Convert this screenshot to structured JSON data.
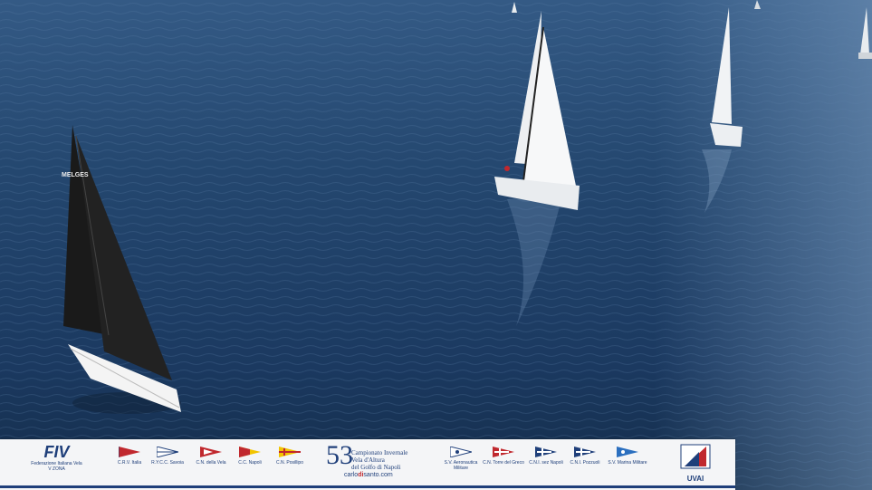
{
  "footer": {
    "federation_mark": "FIV",
    "federation_name": "Federazione Italiana Vela",
    "federation_sub": "V ZONA",
    "event_number": "53",
    "event_line1": "Campionato Invernale",
    "event_line2": "Vela d'Altura",
    "event_line3": "del Golfo di Napoli",
    "event_site_a": "carlo",
    "event_site_b": "di",
    "event_site_c": "santo.com",
    "clubs": [
      "C.R.V. Italia",
      "R.Y.C.C. Savoia",
      "C.N. della Vela",
      "C.C. Napoli",
      "C.N. Posillipo",
      "S.V. Aeronautica Militare",
      "C.N. Torre del Greco",
      "C.N.I. sez Napoli",
      "C.N.I. Pozzuoli",
      "S.V. Marina Militare"
    ],
    "uvai_label": "UVAI"
  },
  "colors": {
    "sea_dark": "#142d4a",
    "sea_mid": "#2a4d75",
    "navy": "#1f3f7a",
    "red": "#c0282e"
  },
  "sail_text": "MELGES"
}
